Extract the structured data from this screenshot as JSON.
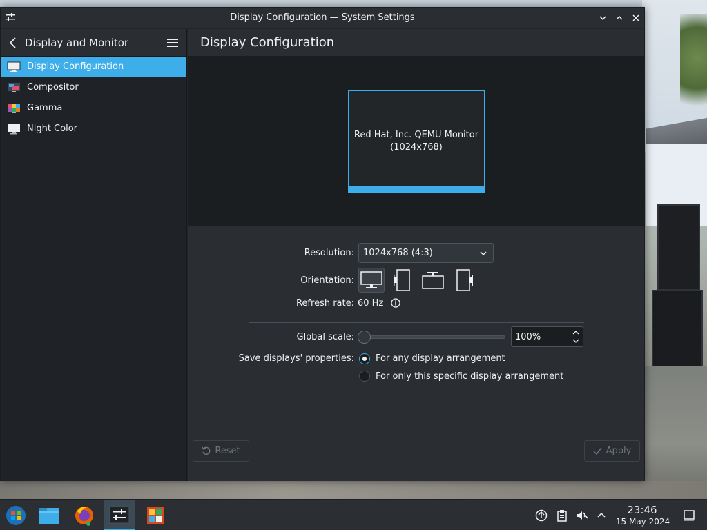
{
  "window": {
    "title": "Display Configuration — System Settings"
  },
  "sidebar": {
    "title": "Display and Monitor",
    "items": [
      {
        "label": "Display Configuration",
        "icon": "monitor-icon",
        "active": true
      },
      {
        "label": "Compositor",
        "icon": "compositor-icon",
        "active": false
      },
      {
        "label": "Gamma",
        "icon": "gamma-icon",
        "active": false
      },
      {
        "label": "Night Color",
        "icon": "night-color-icon",
        "active": false
      }
    ]
  },
  "content": {
    "title": "Display Configuration",
    "monitor": {
      "name": "Red Hat, Inc. QEMU Monitor",
      "resolution": "(1024x768)"
    },
    "resolution": {
      "label": "Resolution:",
      "value": "1024x768 (4:3)"
    },
    "orientation": {
      "label": "Orientation:",
      "options": [
        "landscape",
        "portrait-left",
        "landscape-flipped",
        "portrait-right"
      ],
      "selected": 0
    },
    "refresh": {
      "label": "Refresh rate:",
      "value": "60 Hz"
    },
    "scale": {
      "label": "Global scale:",
      "value": "100%",
      "slider_fraction": 0.0
    },
    "save": {
      "label": "Save displays' properties:",
      "options": [
        "For any display arrangement",
        "For only this specific display arrangement"
      ],
      "selected": 0
    },
    "buttons": {
      "reset": "Reset",
      "apply": "Apply"
    }
  },
  "taskbar": {
    "apps": [
      "start-menu-icon",
      "file-manager-icon",
      "firefox-icon",
      "system-settings-icon",
      "office-icon"
    ],
    "active_app": 3,
    "clock": {
      "time": "23:46",
      "date": "15 May 2024"
    }
  },
  "colors": {
    "accent": "#3daee9",
    "window_bg": "#2a2e32",
    "sidebar_bg": "#1f2226"
  }
}
